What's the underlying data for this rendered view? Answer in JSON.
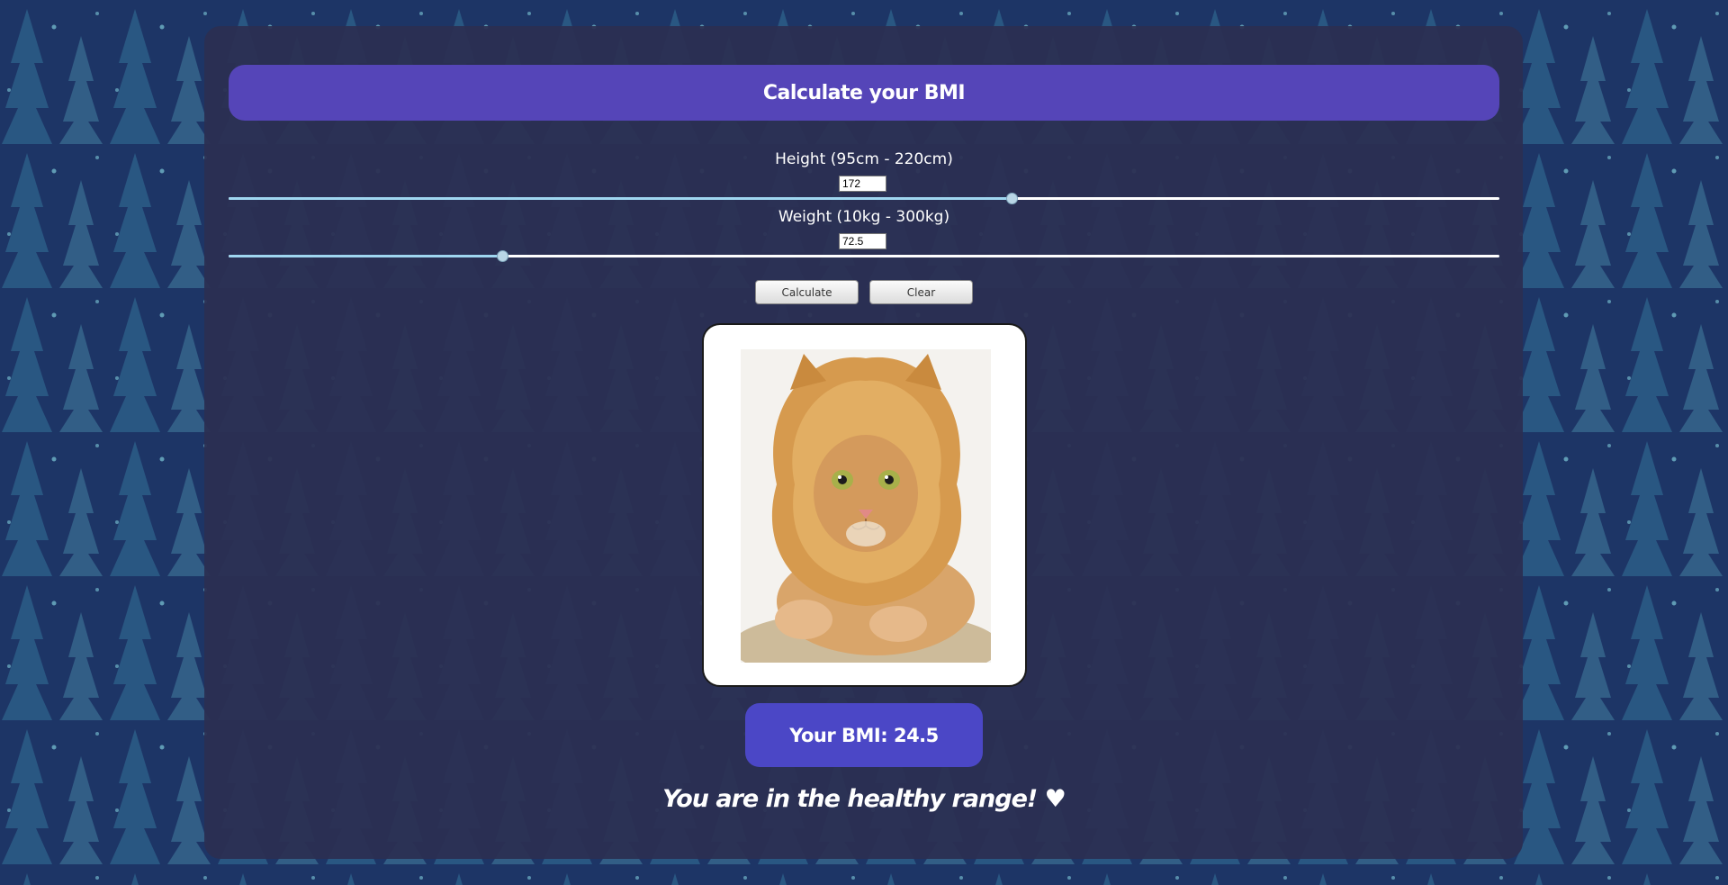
{
  "page": {
    "background_color": "#1d3566",
    "panel_color": "#2b2f52",
    "accent_color": "#5545b8"
  },
  "header": {
    "title": "Calculate your BMI"
  },
  "height_field": {
    "label": "Height (95cm - 220cm)",
    "value": "172",
    "min": 95,
    "max": 220
  },
  "weight_field": {
    "label": "Weight (10kg - 300kg)",
    "value": "72.5",
    "min": 10,
    "max": 300
  },
  "actions": {
    "calculate_label": "Calculate",
    "clear_label": "Clear"
  },
  "result": {
    "image_subject": "cat-in-lion-mane-costume",
    "bmi_text": "Your BMI: 24.5",
    "message": "You are in the healthy range! ♥"
  }
}
